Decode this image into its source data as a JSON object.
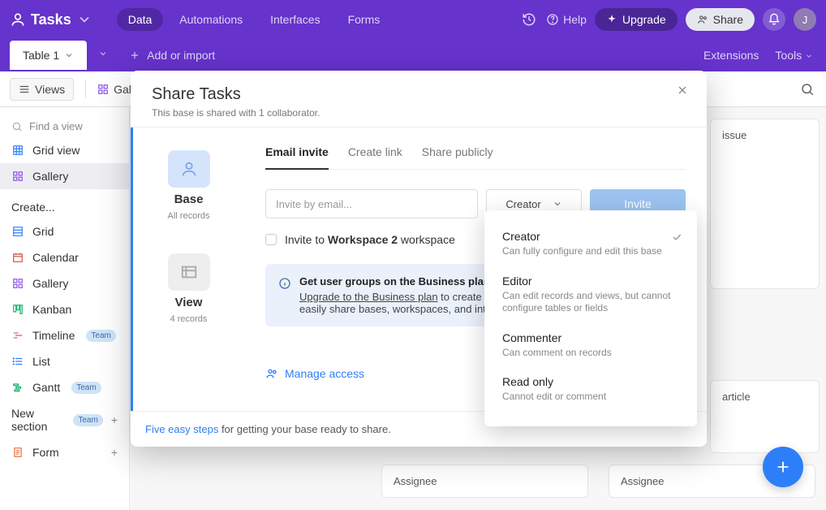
{
  "brand": "Tasks",
  "topnav": {
    "tabs": [
      "Data",
      "Automations",
      "Interfaces",
      "Forms"
    ],
    "help": "Help",
    "upgrade": "Upgrade",
    "share": "Share",
    "avatar_initial": "J"
  },
  "tabbar": {
    "table": "Table 1",
    "add": "Add or import",
    "extensions": "Extensions",
    "tools": "Tools"
  },
  "toolbar": {
    "views": "Views",
    "gallery_prefix": "Gal"
  },
  "sidebar": {
    "search_placeholder": "Find a view",
    "views": [
      {
        "id": "grid-view",
        "label": "Grid view",
        "color": "#2d7ff9"
      },
      {
        "id": "gallery",
        "label": "Gallery",
        "color": "#8a4de8"
      }
    ],
    "create_heading": "Create...",
    "create_items": [
      {
        "id": "grid",
        "label": "Grid",
        "team": false,
        "color": "#2d7ff9"
      },
      {
        "id": "calendar",
        "label": "Calendar",
        "team": false,
        "color": "#d54d3f"
      },
      {
        "id": "gallery2",
        "label": "Gallery",
        "team": false,
        "color": "#8a4de8"
      },
      {
        "id": "kanban",
        "label": "Kanban",
        "team": false,
        "color": "#11af6c"
      },
      {
        "id": "timeline",
        "label": "Timeline",
        "team": true,
        "color": "#e04f7d"
      },
      {
        "id": "list",
        "label": "List",
        "team": false,
        "color": "#2d7ff9"
      },
      {
        "id": "gantt",
        "label": "Gantt",
        "team": true,
        "color": "#11af6c"
      },
      {
        "id": "new-section",
        "label": "New section",
        "team": true,
        "color": "#666",
        "plus": true
      },
      {
        "id": "form",
        "label": "Form",
        "team": false,
        "color": "#e86e3e",
        "plus": true
      }
    ],
    "team_badge": "Team"
  },
  "cards": {
    "issue_tail": "issue",
    "article_tail": "article",
    "assignee": "Assignee"
  },
  "modal": {
    "title": "Share Tasks",
    "subtitle": "This base is shared with 1 collaborator.",
    "scopes": [
      {
        "id": "base",
        "label": "Base",
        "sub": "All records"
      },
      {
        "id": "view",
        "label": "View",
        "sub": "4 records"
      }
    ],
    "share_tabs": [
      "Email invite",
      "Create link",
      "Share publicly"
    ],
    "email_placeholder": "Invite by email...",
    "role_selected": "Creator",
    "invite_btn": "Invite",
    "workspace_prefix": "Invite to ",
    "workspace_name": "Workspace 2",
    "workspace_suffix": " workspace",
    "banner_title": "Get user groups on the Business plan",
    "banner_link": "Upgrade to the Business plan",
    "banner_rest": " to create and manage user groups so you can easily share bases, workspaces, and interfaces.",
    "manage": "Manage access",
    "footer_link": "Five easy steps",
    "footer_rest": " for getting your base ready to share."
  },
  "roles": [
    {
      "name": "Creator",
      "desc": "Can fully configure and edit this base",
      "selected": true
    },
    {
      "name": "Editor",
      "desc": "Can edit records and views, but cannot configure tables or fields",
      "selected": false
    },
    {
      "name": "Commenter",
      "desc": "Can comment on records",
      "selected": false
    },
    {
      "name": "Read only",
      "desc": "Cannot edit or comment",
      "selected": false
    }
  ]
}
